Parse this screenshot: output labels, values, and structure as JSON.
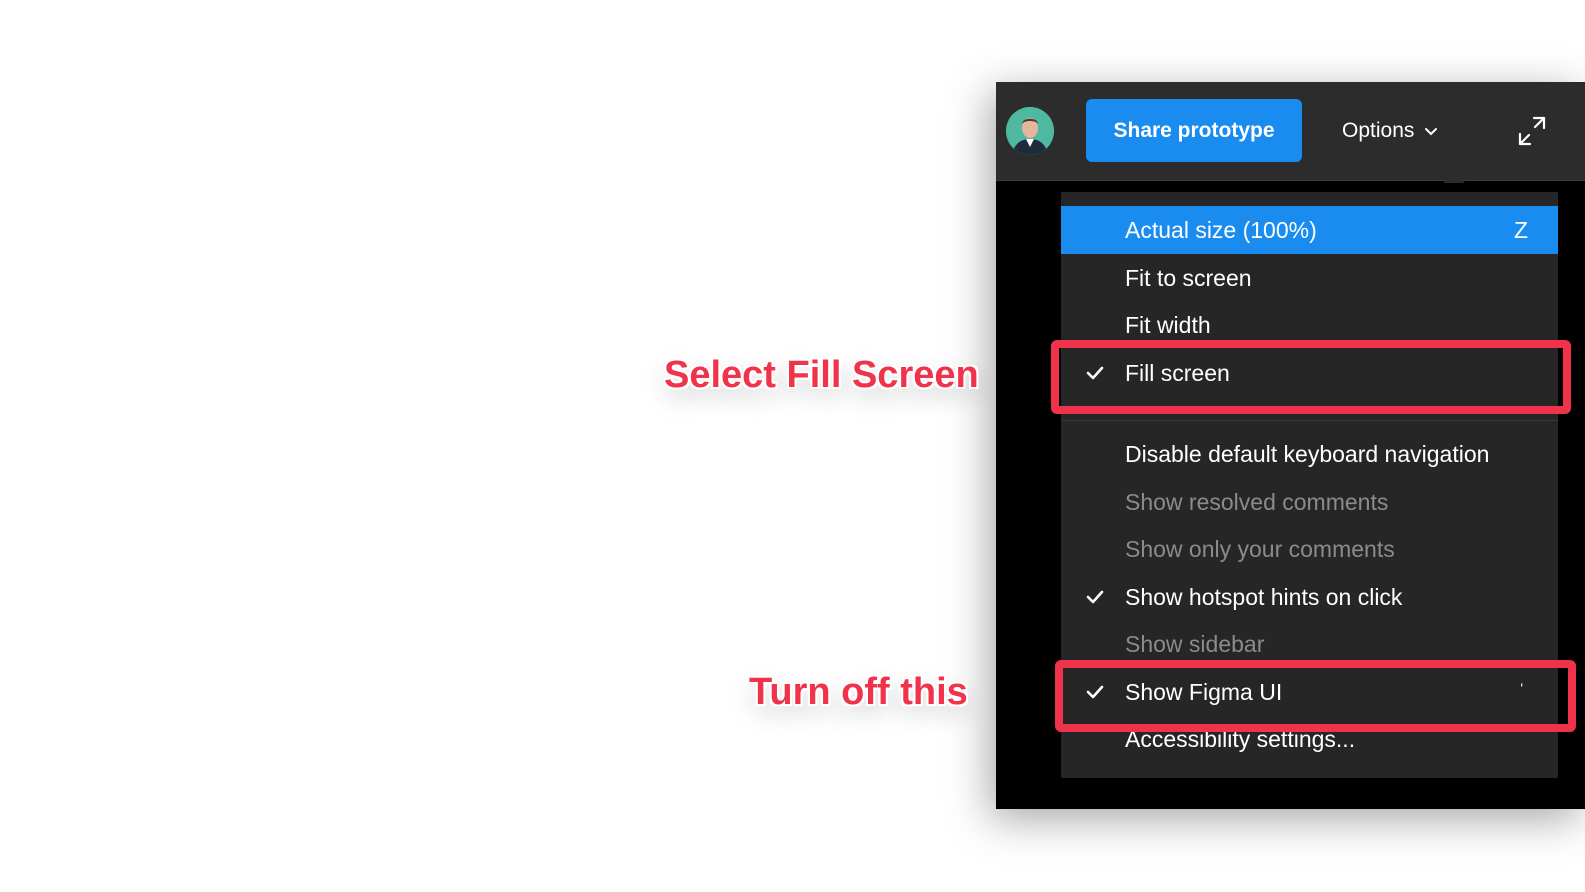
{
  "topbar": {
    "share_label": "Share prototype",
    "options_label": "Options"
  },
  "menu": {
    "items": [
      {
        "label": "Actual size (100%)",
        "shortcut": "Z",
        "checked": false,
        "state": "highlighted"
      },
      {
        "label": "Fit to screen",
        "shortcut": "",
        "checked": false,
        "state": "normal"
      },
      {
        "label": "Fit width",
        "shortcut": "",
        "checked": false,
        "state": "normal"
      },
      {
        "label": "Fill screen",
        "shortcut": "",
        "checked": true,
        "state": "normal"
      },
      {
        "label": "Disable default keyboard navigation",
        "shortcut": "",
        "checked": false,
        "state": "normal"
      },
      {
        "label": "Show resolved comments",
        "shortcut": "",
        "checked": false,
        "state": "disabled"
      },
      {
        "label": "Show only your comments",
        "shortcut": "",
        "checked": false,
        "state": "disabled"
      },
      {
        "label": "Show hotspot hints on click",
        "shortcut": "",
        "checked": true,
        "state": "normal"
      },
      {
        "label": "Show sidebar",
        "shortcut": "",
        "checked": false,
        "state": "disabled"
      },
      {
        "label": "Show Figma UI",
        "shortcut": "'",
        "checked": true,
        "state": "normal"
      },
      {
        "label": "Accessibility settings...",
        "shortcut": "",
        "checked": false,
        "state": "normal"
      }
    ]
  },
  "annotations": {
    "fill_screen": "Select Fill Screen",
    "figma_ui": "Turn off this"
  },
  "colors": {
    "accent": "#1a8cf0",
    "highlight": "#f0334b",
    "menu_bg": "#262626",
    "toolbar_bg": "#2c2c2c"
  },
  "icons": {
    "avatar": "user-avatar",
    "dropdown": "chevron-down-icon",
    "expand": "expand-icon",
    "check": "checkmark-icon"
  }
}
